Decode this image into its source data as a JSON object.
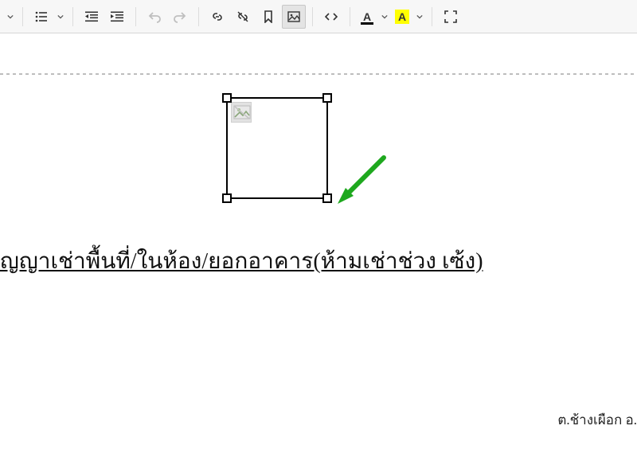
{
  "toolbar": {
    "font_color_letter": "A",
    "bg_color_letter": "A"
  },
  "editor": {
    "body_text": "ัญญาเช่าพื้นที่/ในห้อง/ยอกอาคาร(ห้ามเช่าช่วง เซ้ง)",
    "footer_text": "ต.ช้างเผือก อ."
  }
}
